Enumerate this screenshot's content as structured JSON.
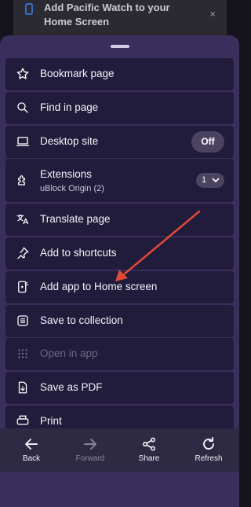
{
  "banner": {
    "text": "Add Pacific Watch to your Home Screen",
    "close": "×"
  },
  "menu": {
    "items": [
      {
        "label": "Bookmark page",
        "icon": "star-icon"
      },
      {
        "label": "Find in page",
        "icon": "search-icon"
      },
      {
        "label": "Desktop site",
        "icon": "laptop-icon",
        "toggle": "Off"
      },
      {
        "label": "Extensions",
        "icon": "puzzle-icon",
        "sub": "uBlock Origin (2)",
        "badge": "1"
      },
      {
        "label": "Translate page",
        "icon": "translate-icon"
      },
      {
        "label": "Add to shortcuts",
        "icon": "pin-icon"
      },
      {
        "label": "Add app to Home screen",
        "icon": "add-to-homescreen-icon"
      },
      {
        "label": "Save to collection",
        "icon": "collection-icon"
      },
      {
        "label": "Open in app",
        "icon": "open-in-app-icon",
        "disabled": true
      },
      {
        "label": "Save as PDF",
        "icon": "pdf-icon"
      },
      {
        "label": "Print",
        "icon": "print-icon"
      }
    ]
  },
  "toolbar": {
    "back": "Back",
    "forward": "Forward",
    "share": "Share",
    "refresh": "Refresh"
  },
  "colors": {
    "sheet": "#3a2f5c",
    "item": "#211c3b",
    "annotation_arrow": "#e0483a"
  }
}
